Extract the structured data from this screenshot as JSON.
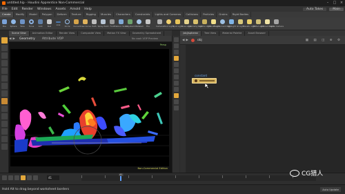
{
  "title_bar": {
    "title": "untitled.hip - Houdini Apprentice Non-Commercial",
    "buttons": [
      "minimize",
      "maximize",
      "close"
    ]
  },
  "menu": {
    "items": [
      "File",
      "Edit",
      "Render",
      "Windows",
      "Assets",
      "Arnold",
      "Help"
    ],
    "right": {
      "auto_takes": "Auto Takes",
      "desktop": "Main"
    }
  },
  "shelf_tabs": [
    "Create",
    "Modify",
    "Model",
    "Polygon",
    "Deform",
    "Texture",
    "Rigging",
    "Muscles",
    "Characters",
    "Constraints",
    "Hair Utils",
    "Guide Process",
    "Guide Brushes",
    "Terrain FX",
    "Cloud FX",
    "Volume",
    "Lights and Cameras",
    "Collisions",
    "Particles",
    "Grains",
    "Rigid Bodies",
    "Particle Fluids",
    "Viscous Fluids",
    "Oceans",
    "Fluid Containers",
    "Populate Containers",
    "Container Tools",
    "Pyro FX",
    "Sparse Pyro FX",
    "FEM",
    "Wires",
    "Crowds",
    "Drive Simulation"
  ],
  "shelf_tools": [
    "Box",
    "Sphere",
    "Tube",
    "Torus",
    "Grid",
    "Null",
    "Line",
    "Circle",
    "Curve",
    "Draw Curve",
    "Path",
    "Spray Paint",
    "Font",
    "Platonic Solids",
    "L-System",
    "Metaball",
    "File"
  ],
  "light_tools": [
    "Camera",
    "Point Light",
    "Spot Light",
    "Area Light",
    "Geometry Light",
    "Volume Light",
    "Distant Light",
    "Environment Light",
    "Sky Light",
    "GI Light",
    "Caustic Light",
    "Portal Light",
    "Ambient Light",
    "Stereo Camera",
    "VR Camera",
    "Switcher"
  ],
  "scene_tabs": [
    "Scene View",
    "Animation Editor",
    "Render View",
    "Composite View",
    "Motion FX View",
    "Geometry Spreadsheet"
  ],
  "viewport": {
    "path": "Geometry",
    "sub": "Attribute VOP",
    "menu": "No cook VOP Preview",
    "top_right_label": "Persp",
    "watermark": "Non-Commercial Edition"
  },
  "network": {
    "tabs": [
      "/obj/spherez",
      "Tree View",
      "Material Palette",
      "Asset Browser"
    ],
    "path": "obj",
    "node_label": "constant"
  },
  "timeline": {
    "frame": "41",
    "ruler_frame": "41"
  },
  "status": {
    "message": "Hold Alt to drag beyond worksheet borders",
    "auto_update": "Auto Update"
  },
  "watermark": {
    "text": "CG猎人"
  },
  "colors": {
    "accent": "#e2a73b",
    "node": "#d9b760"
  }
}
